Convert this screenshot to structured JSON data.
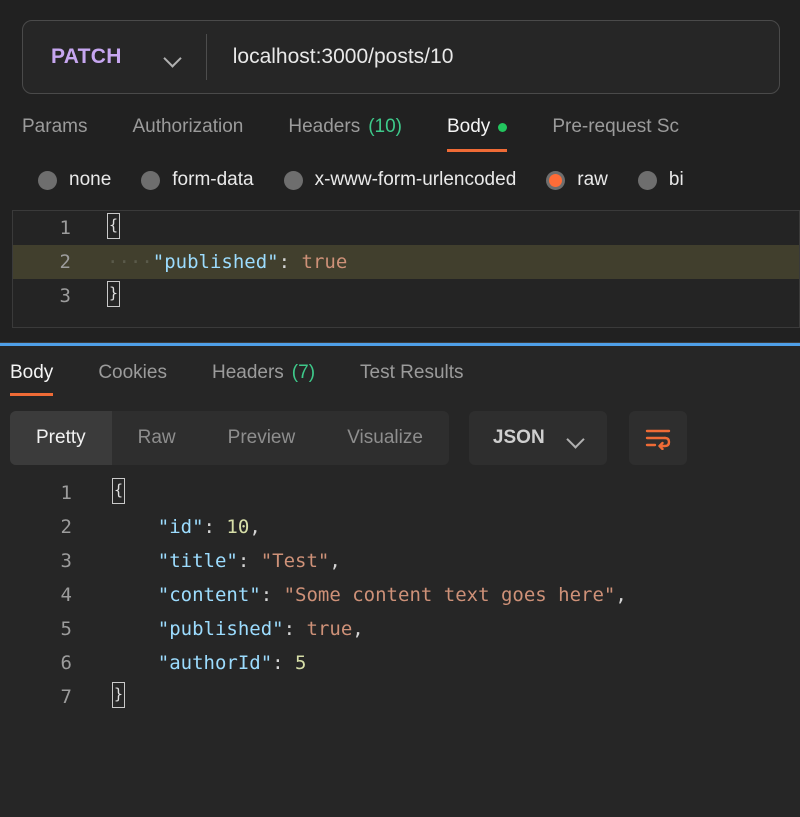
{
  "request": {
    "method": "PATCH",
    "method_color": "#c6a6f0",
    "url": "localhost:3000/posts/10",
    "dropdown_icon": "chevron-down-icon",
    "tabs": [
      {
        "label": "Params",
        "count": "",
        "active": false,
        "dot": false
      },
      {
        "label": "Authorization",
        "count": "",
        "active": false,
        "dot": false
      },
      {
        "label": "Headers",
        "count": "(10)",
        "active": false,
        "dot": false
      },
      {
        "label": "Body",
        "count": "",
        "active": true,
        "dot": true
      },
      {
        "label": "Pre-request Sc",
        "count": "",
        "active": false,
        "dot": false
      }
    ],
    "body_types": [
      {
        "label": "none",
        "selected": false
      },
      {
        "label": "form-data",
        "selected": false
      },
      {
        "label": "x-www-form-urlencoded",
        "selected": false
      },
      {
        "label": "raw",
        "selected": true
      },
      {
        "label": "bi",
        "selected": false
      }
    ],
    "editor": {
      "lines": [
        {
          "num": "1",
          "indent": "",
          "content": "{",
          "highlighted": false
        },
        {
          "num": "2",
          "indent": "····",
          "key": "\"published\"",
          "colon": ": ",
          "value": "true",
          "value_type": "boolean",
          "highlighted": true
        },
        {
          "num": "3",
          "indent": "",
          "content": "}",
          "highlighted": false
        }
      ]
    }
  },
  "response": {
    "tabs": [
      {
        "label": "Body",
        "count": "",
        "active": true
      },
      {
        "label": "Cookies",
        "count": "",
        "active": false
      },
      {
        "label": "Headers",
        "count": "(7)",
        "active": false
      },
      {
        "label": "Test Results",
        "count": "",
        "active": false
      }
    ],
    "view_modes": [
      {
        "label": "Pretty",
        "active": true
      },
      {
        "label": "Raw",
        "active": false
      },
      {
        "label": "Preview",
        "active": false
      },
      {
        "label": "Visualize",
        "active": false
      }
    ],
    "format": {
      "value": "JSON",
      "dropdown_icon": "chevron-down-icon"
    },
    "wrap_button": {
      "icon": "wrap-text-icon",
      "color": "#ef6b36"
    },
    "body_lines": [
      {
        "num": "1",
        "indent": "",
        "brace": "{"
      },
      {
        "num": "2",
        "indent": "    ",
        "key": "\"id\"",
        "colon": ": ",
        "value": "10",
        "value_type": "number",
        "trail": ","
      },
      {
        "num": "3",
        "indent": "    ",
        "key": "\"title\"",
        "colon": ": ",
        "value": "\"Test\"",
        "value_type": "string",
        "trail": ","
      },
      {
        "num": "4",
        "indent": "    ",
        "key": "\"content\"",
        "colon": ": ",
        "value": "\"Some content text goes here\"",
        "value_type": "string",
        "trail": ","
      },
      {
        "num": "5",
        "indent": "    ",
        "key": "\"published\"",
        "colon": ": ",
        "value": "true",
        "value_type": "boolean",
        "trail": ","
      },
      {
        "num": "6",
        "indent": "    ",
        "key": "\"authorId\"",
        "colon": ": ",
        "value": "5",
        "value_type": "number",
        "trail": ""
      },
      {
        "num": "7",
        "indent": "",
        "brace": "}"
      }
    ]
  },
  "theme": {
    "background": "#212121",
    "panel": "#262626",
    "accent_orange": "#ef6b36",
    "accent_green": "#22c55e",
    "divider_blue": "#4f9fe8",
    "key_blue": "#9cdcfe",
    "string_orange": "#ce9178",
    "number_olive": "#d7dfa8",
    "highlight_line": "#413f2d"
  }
}
